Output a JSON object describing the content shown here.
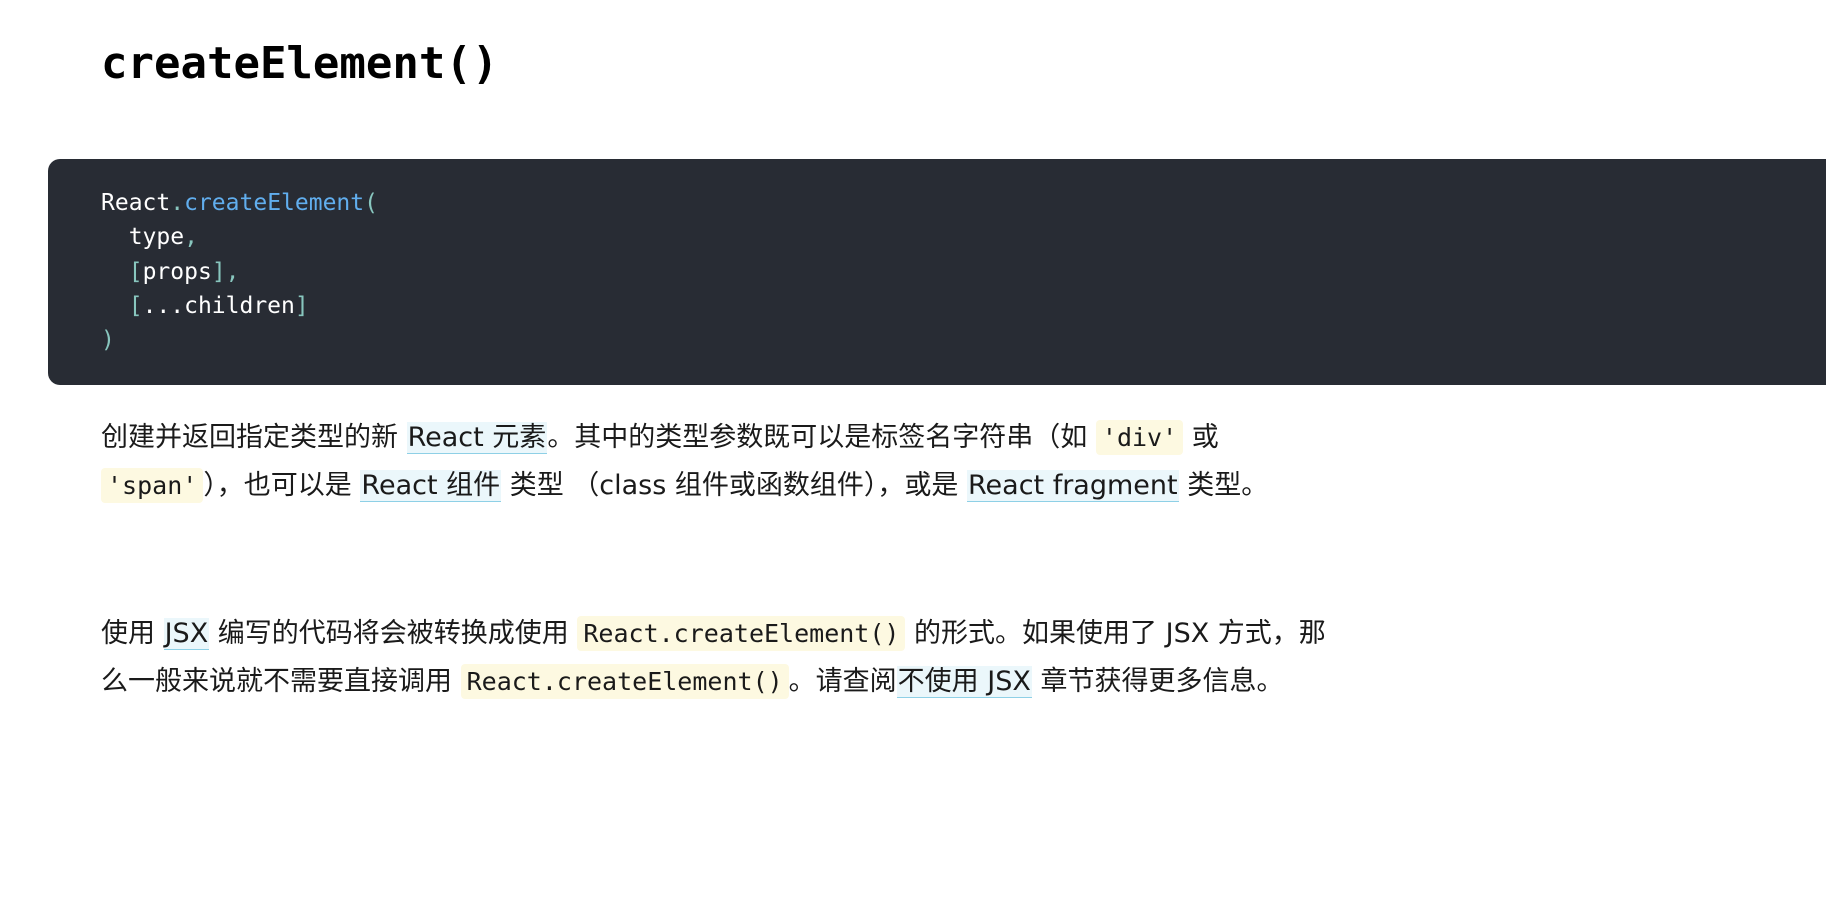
{
  "heading": {
    "title": "createElement()"
  },
  "code": {
    "lines": [
      [
        {
          "t": "React",
          "k": "plain"
        },
        {
          "t": ".",
          "k": "punct"
        },
        {
          "t": "createElement",
          "k": "method"
        },
        {
          "t": "(",
          "k": "punct"
        }
      ],
      [
        {
          "t": "  ",
          "k": "ws"
        },
        {
          "t": "type",
          "k": "plain"
        },
        {
          "t": ",",
          "k": "punct"
        }
      ],
      [
        {
          "t": "  ",
          "k": "ws"
        },
        {
          "t": "[",
          "k": "punct"
        },
        {
          "t": "props",
          "k": "plain"
        },
        {
          "t": "]",
          "k": "punct"
        },
        {
          "t": ",",
          "k": "punct"
        }
      ],
      [
        {
          "t": "  ",
          "k": "ws"
        },
        {
          "t": "[",
          "k": "punct"
        },
        {
          "t": "...children",
          "k": "plain"
        },
        {
          "t": "]",
          "k": "punct"
        }
      ],
      [
        {
          "t": ")",
          "k": "punct"
        }
      ]
    ]
  },
  "paragraphs": [
    {
      "id": "para-1",
      "parts": [
        {
          "type": "text",
          "text": "创建并返回指定类型的新 "
        },
        {
          "type": "link",
          "text": "React 元素",
          "name": "react-element-link"
        },
        {
          "type": "text",
          "text": "。其中的类型参数既可以是标签名字符串（如 "
        },
        {
          "type": "code",
          "text": "'div'",
          "name": "inline-code-div"
        },
        {
          "type": "text",
          "text": " 或 "
        },
        {
          "type": "code",
          "text": "'span'",
          "name": "inline-code-span"
        },
        {
          "type": "text",
          "text": "），也可以是 "
        },
        {
          "type": "link",
          "text": "React 组件",
          "name": "react-component-link"
        },
        {
          "type": "text",
          "text": " 类型 （class 组件或函数组件），或是 "
        },
        {
          "type": "link",
          "text": "React fragment",
          "name": "react-fragment-link"
        },
        {
          "type": "text",
          "text": " 类型。"
        }
      ]
    },
    {
      "id": "para-2",
      "parts": [
        {
          "type": "text",
          "text": "使用 "
        },
        {
          "type": "link",
          "text": "JSX",
          "name": "jsx-link"
        },
        {
          "type": "text",
          "text": " 编写的代码将会被转换成使用 "
        },
        {
          "type": "code",
          "text": "React.createElement()",
          "name": "inline-code-create-element"
        },
        {
          "type": "text",
          "text": " 的形式。如果使用了 JSX 方式，那么一般来说就不需要直接调用 "
        },
        {
          "type": "code",
          "text": "React.createElement()",
          "name": "inline-code-create-element"
        },
        {
          "type": "text",
          "text": "。请查阅"
        },
        {
          "type": "link",
          "text": "不使用 JSX",
          "name": "without-jsx-link"
        },
        {
          "type": "text",
          "text": " 章节获得更多信息。"
        }
      ]
    }
  ]
}
